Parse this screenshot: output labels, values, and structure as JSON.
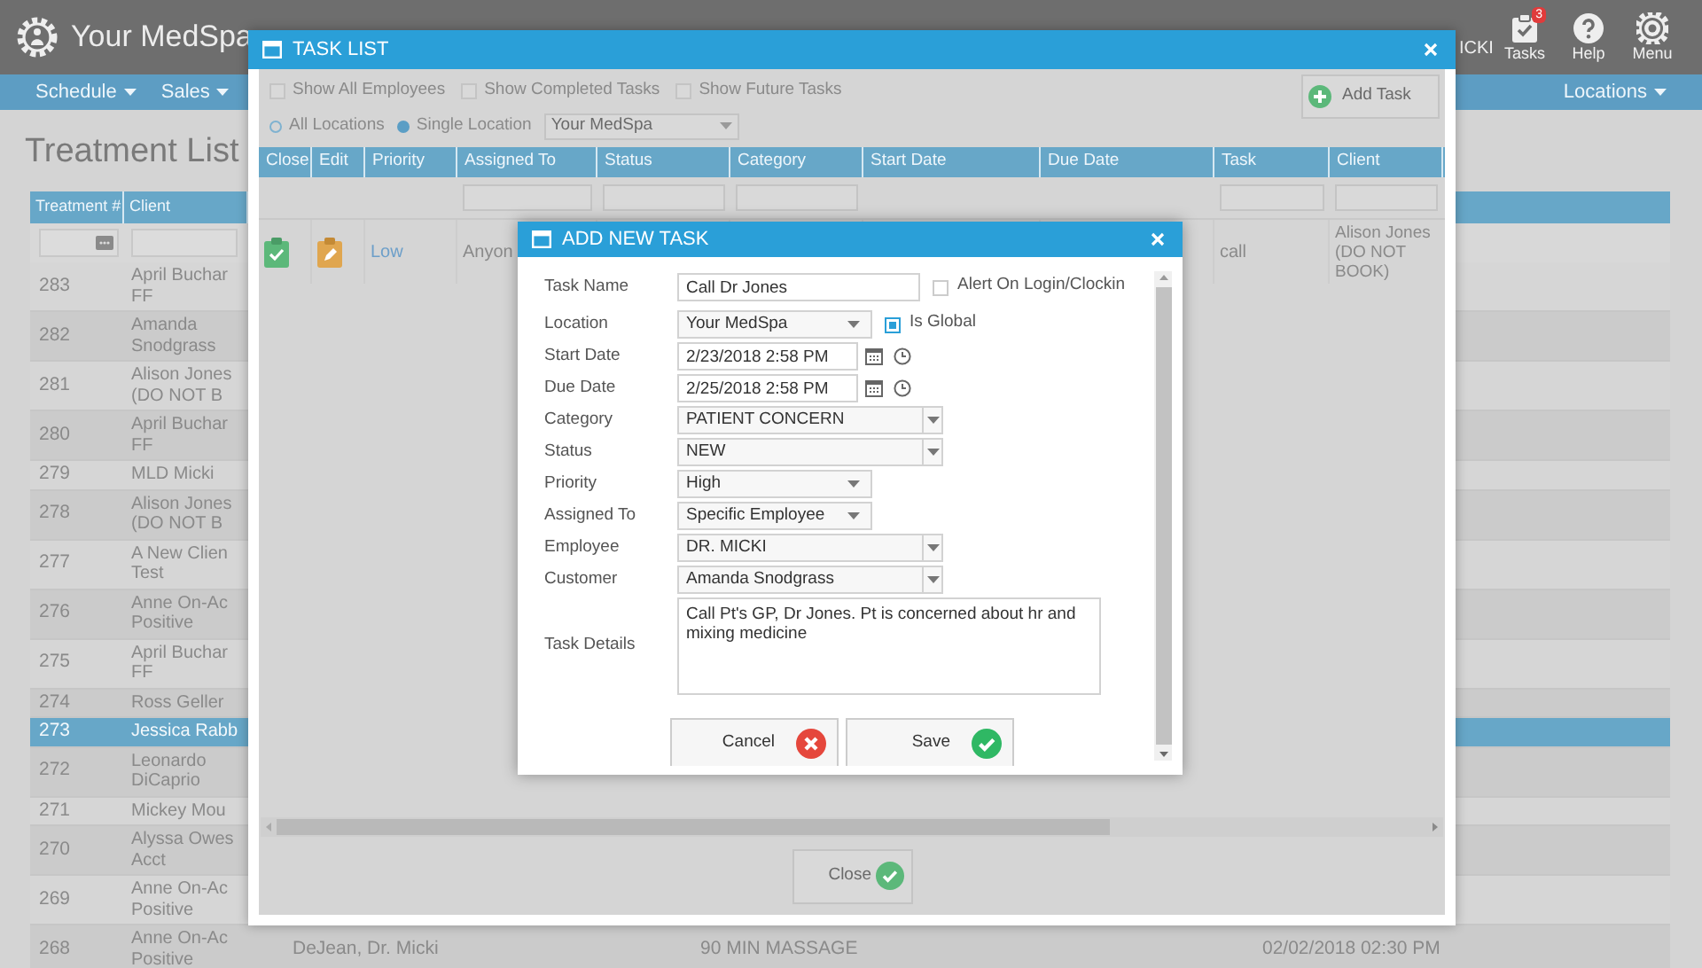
{
  "app": {
    "logo_text": "Your MedSpa",
    "user_name": "ICKI",
    "toolbar": [
      {
        "kind": "tasks",
        "label": "Tasks",
        "badge": "3"
      },
      {
        "kind": "help",
        "label": "Help"
      },
      {
        "kind": "menu",
        "label": "Menu"
      }
    ]
  },
  "nav": {
    "left": [
      {
        "label": "Schedule"
      },
      {
        "label": "Sales"
      }
    ],
    "right": [
      {
        "label": "Locations"
      }
    ]
  },
  "page_title": "Treatment List",
  "treatment_table": {
    "columns": [
      "Treatment #",
      "Client"
    ],
    "rows": [
      {
        "number": "283",
        "client": "April Buchar\nFF",
        "selected": false
      },
      {
        "number": "282",
        "client": "Amanda\nSnodgrass",
        "selected": false
      },
      {
        "number": "281",
        "client": "Alison Jones\n(DO NOT B",
        "selected": false
      },
      {
        "number": "280",
        "client": "April Buchar\nFF",
        "selected": false
      },
      {
        "number": "279",
        "client": "MLD Micki",
        "selected": false
      },
      {
        "number": "278",
        "client": "Alison Jones\n(DO NOT B",
        "selected": false
      },
      {
        "number": "277",
        "client": "A New Clien\nTest",
        "selected": false
      },
      {
        "number": "276",
        "client": "Anne On-Ac\nPositive",
        "selected": false
      },
      {
        "number": "275",
        "client": "April Buchar\nFF",
        "selected": false
      },
      {
        "number": "274",
        "client": "Ross Geller",
        "selected": false
      },
      {
        "number": "273",
        "client": "Jessica Rabb",
        "selected": true
      },
      {
        "number": "272",
        "client": "Leonardo\nDiCaprio",
        "selected": false
      },
      {
        "number": "271",
        "client": "Mickey Mou",
        "selected": false
      },
      {
        "number": "270",
        "client": "Alyssa Owes\nAcct",
        "selected": false
      },
      {
        "number": "269",
        "client": "Anne On-Ac\nPositive",
        "selected": false
      },
      {
        "number": "268",
        "client": "Anne On-Ac\nPositive",
        "selected": false,
        "cells": [
          "DeJean, Dr. Micki",
          "90 MIN MASSAGE",
          "02/02/2018 02:30 PM"
        ]
      }
    ]
  },
  "task_list_dialog": {
    "title": "TASK LIST",
    "filters": [
      {
        "label": "Show All Employees",
        "checked": false
      },
      {
        "label": "Show Completed Tasks",
        "checked": false
      },
      {
        "label": "Show Future Tasks",
        "checked": false
      }
    ],
    "location_options": [
      {
        "label": "All Locations",
        "selected": false
      },
      {
        "label": "Single Location",
        "selected": true
      }
    ],
    "location_select": "Your MedSpa",
    "add_button": "Add Task",
    "columns": [
      {
        "label": "Close",
        "filter": false
      },
      {
        "label": "Edit",
        "filter": false
      },
      {
        "label": "Priority",
        "filter": false
      },
      {
        "label": "Assigned To",
        "filter": true
      },
      {
        "label": "Status",
        "filter": true
      },
      {
        "label": "Category",
        "filter": true
      },
      {
        "label": "Start Date",
        "filter": false
      },
      {
        "label": "Due Date",
        "filter": false
      },
      {
        "label": "Task",
        "filter": true
      },
      {
        "label": "Client",
        "filter": true
      }
    ],
    "rows": [
      {
        "priority": "Low",
        "assigned_to": "Anyon",
        "task": "call",
        "client": "Alison Jones\n(DO NOT\nBOOK)"
      }
    ],
    "close_button": "Close"
  },
  "add_task_dialog": {
    "title": "ADD NEW TASK",
    "fields": [
      {
        "label": "Task Name",
        "kind": "text",
        "value": "Call Dr Jones",
        "checkbox": {
          "label": "Alert On Login/Clockin",
          "checked": false
        }
      },
      {
        "label": "Location",
        "kind": "select",
        "value": "Your MedSpa",
        "checkbox": {
          "label": "Is Global",
          "checked": true
        }
      },
      {
        "label": "Start Date",
        "kind": "datetime",
        "value": "2/23/2018 2:58 PM"
      },
      {
        "label": "Due Date",
        "kind": "datetime",
        "value": "2/25/2018 2:58 PM"
      },
      {
        "label": "Category",
        "kind": "combo",
        "value": "PATIENT CONCERN"
      },
      {
        "label": "Status",
        "kind": "combo",
        "value": "NEW"
      },
      {
        "label": "Priority",
        "kind": "select",
        "value": "High"
      },
      {
        "label": "Assigned To",
        "kind": "select",
        "value": "Specific Employee"
      },
      {
        "label": "Employee",
        "kind": "combo",
        "value": "DR. MICKI"
      },
      {
        "label": "Customer",
        "kind": "combo",
        "value": "Amanda Snodgrass"
      },
      {
        "label": "Task Details",
        "kind": "textarea",
        "value": "Call Pt's GP, Dr Jones. Pt is concerned about hr and mixing medicine"
      }
    ],
    "buttons": [
      {
        "label": "Cancel",
        "kind": "cancel"
      },
      {
        "label": "Save",
        "kind": "save"
      }
    ]
  }
}
